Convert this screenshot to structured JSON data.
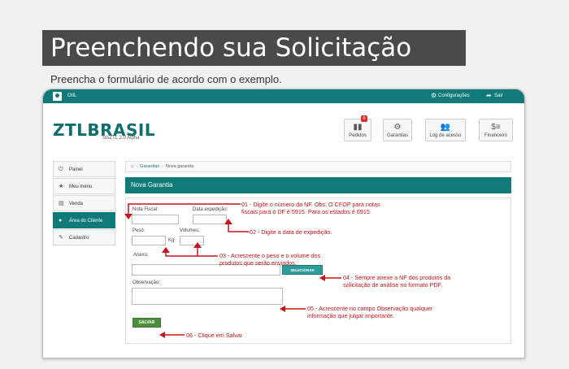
{
  "banner": {
    "title": "Preenchendo sua Solicitação",
    "subtitle": "Preencha o formulário de acordo com o exemplo."
  },
  "topbar": {
    "username": "OIIL",
    "settings_label": "Configurações",
    "logout_label": "Sair"
  },
  "brand": {
    "logo": "ZTLBRASIL",
    "version": "SisZTL 2.0 Alpha"
  },
  "top_buttons": [
    {
      "label": "Pedidos",
      "badge": "0"
    },
    {
      "label": "Garantias"
    },
    {
      "label": "Log de acesso"
    },
    {
      "label": "Financeiro"
    }
  ],
  "sidebar": {
    "items": [
      {
        "label": "Painel"
      },
      {
        "label": "Meu menu"
      },
      {
        "label": "Venda"
      },
      {
        "label": "Área do Cliente",
        "active": true
      },
      {
        "label": "Cadastro"
      }
    ]
  },
  "breadcrumb": {
    "section": "Garantias",
    "current": "Nova garantia"
  },
  "panel": {
    "title": "Nova Garantia"
  },
  "form": {
    "nota_fiscal_label": "Nota Fiscal:",
    "data_expedicao_label": "Data expedição:",
    "peso_label": "Peso:",
    "peso_unit": "Kg",
    "volumes_label": "Volumes:",
    "anexo_label": "Anexo:",
    "selecionar_label": "SELECIONAR",
    "observacao_label": "Observação:",
    "salvar_label": "SALVAR"
  },
  "notes": {
    "n01_line1": "01 - Digite o número da NF. Obs: O CFOP para notas",
    "n01_line2": "fiscais para o DF é 5915. Para os estados é 6915.",
    "n02": "02 - Digite a data de expedição.",
    "n03_line1": "03 - Acrescente o peso e o volume dos",
    "n03_line2": "produtos que serão enviados.",
    "n04_line1": "04 - Sempre anexe a NF dos produtos da",
    "n04_line2": "solicitação de análise no formato PDF.",
    "n05_line1": "05 - Acrescente no campo Observação qualquer",
    "n05_line2": "informação que julgar importante.",
    "n06": "06 - Clique em Salvar"
  },
  "colors": {
    "teal": "#0f7a78",
    "annotation_red": "#c8141b",
    "banner_bg": "#4a4a4a",
    "save_green": "#4b8f3a"
  }
}
